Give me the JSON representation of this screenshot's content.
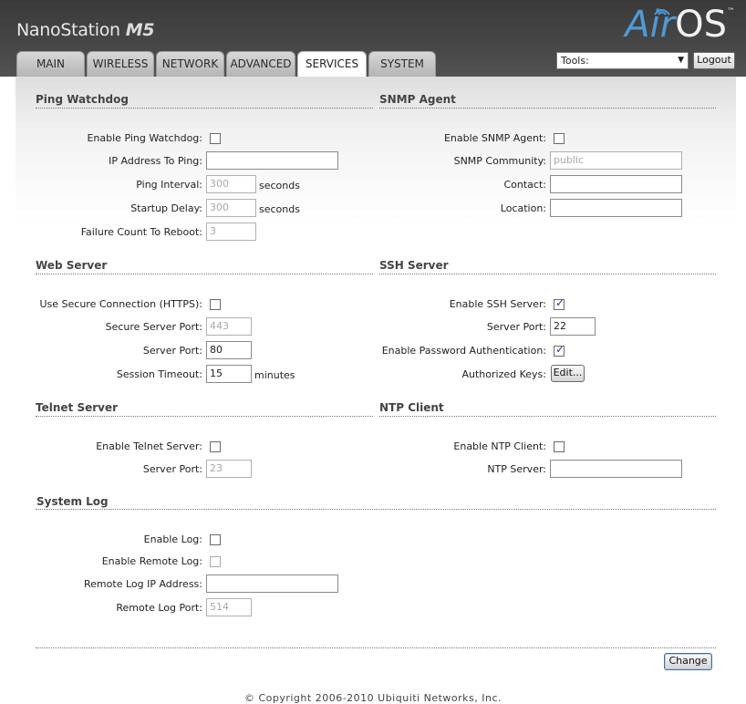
{
  "brand": {
    "name": "NanoStation",
    "model": "M5"
  },
  "logo": {
    "air": "Air",
    "os": "OS",
    "tm": "™"
  },
  "tabs": [
    "MAIN",
    "WIRELESS",
    "NETWORK",
    "ADVANCED",
    "SERVICES",
    "SYSTEM"
  ],
  "active_tab": "SERVICES",
  "tools": {
    "label": "Tools:"
  },
  "logout_label": "Logout",
  "ping_watchdog": {
    "title": "Ping Watchdog",
    "enable_label": "Enable Ping Watchdog:",
    "ip_label": "IP Address To Ping:",
    "ip_value": "",
    "interval_label": "Ping Interval:",
    "interval_value": "300",
    "interval_unit": "seconds",
    "delay_label": "Startup Delay:",
    "delay_value": "300",
    "delay_unit": "seconds",
    "failure_label": "Failure Count To Reboot:",
    "failure_value": "3"
  },
  "snmp": {
    "title": "SNMP Agent",
    "enable_label": "Enable SNMP Agent:",
    "community_label": "SNMP Community:",
    "community_value": "public",
    "contact_label": "Contact:",
    "contact_value": "",
    "location_label": "Location:",
    "location_value": ""
  },
  "web_server": {
    "title": "Web Server",
    "secure_label": "Use Secure Connection (HTTPS):",
    "secure_port_label": "Secure Server Port:",
    "secure_port_value": "443",
    "port_label": "Server Port:",
    "port_value": "80",
    "timeout_label": "Session Timeout:",
    "timeout_value": "15",
    "timeout_unit": "minutes"
  },
  "ssh_server": {
    "title": "SSH Server",
    "enable_label": "Enable SSH Server:",
    "port_label": "Server Port:",
    "port_value": "22",
    "password_label": "Enable Password Authentication:",
    "keys_label": "Authorized Keys:",
    "edit_label": "Edit..."
  },
  "telnet": {
    "title": "Telnet Server",
    "enable_label": "Enable Telnet Server:",
    "port_label": "Server Port:",
    "port_value": "23"
  },
  "ntp": {
    "title": "NTP Client",
    "enable_label": "Enable NTP Client:",
    "server_label": "NTP Server:",
    "server_value": ""
  },
  "system_log": {
    "title": "System Log",
    "enable_label": "Enable Log:",
    "remote_label": "Enable Remote Log:",
    "remote_ip_label": "Remote Log IP Address:",
    "remote_ip_value": "",
    "remote_port_label": "Remote Log Port:",
    "remote_port_value": "514"
  },
  "change_label": "Change",
  "footer": "© Copyright 2006-2010 Ubiquiti Networks, Inc.",
  "colors": {
    "accent": "#4f9ad6",
    "header_bg": "#474747",
    "check": "#1e3b8c"
  }
}
